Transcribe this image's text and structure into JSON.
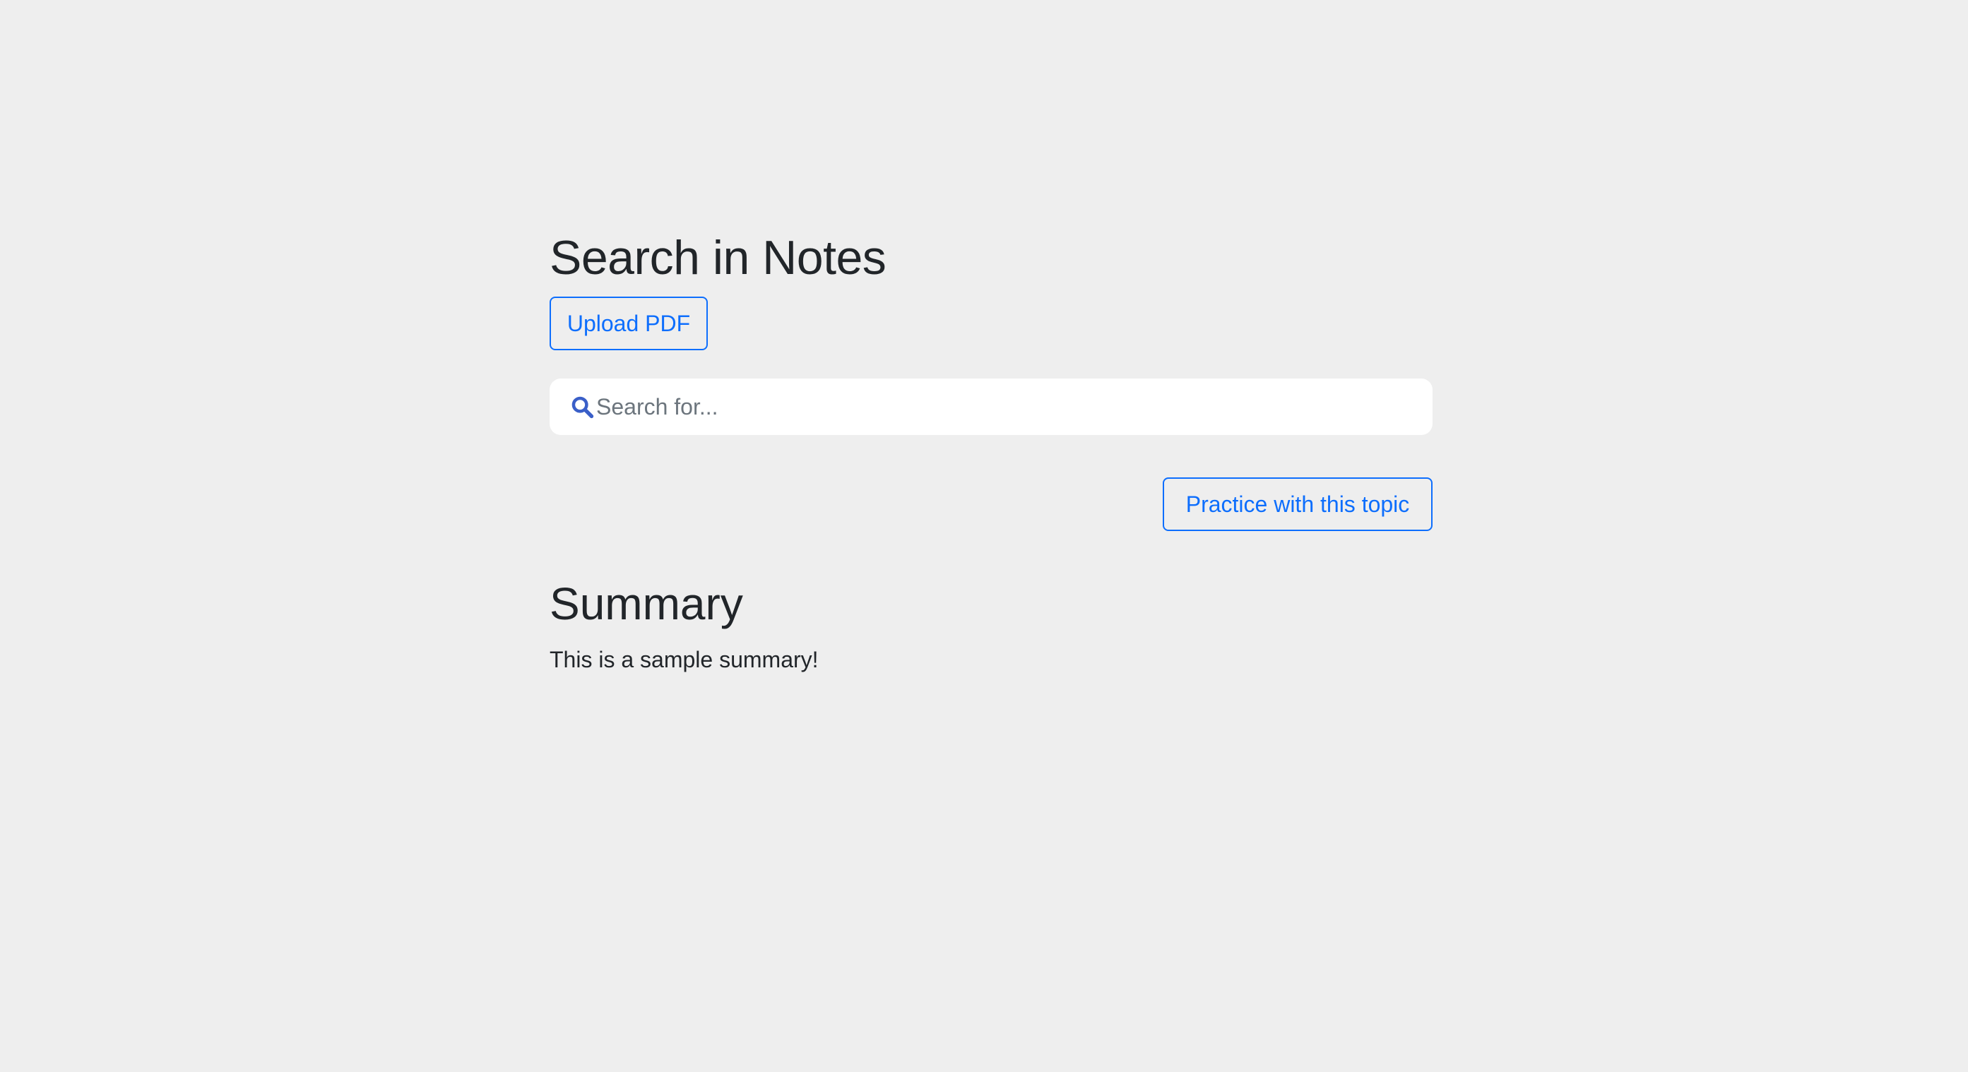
{
  "header": {
    "title": "Search in Notes",
    "upload_label": "Upload PDF"
  },
  "search": {
    "icon": "search-icon",
    "placeholder": "Search for...",
    "value": ""
  },
  "actions": {
    "practice_label": "Practice with this topic"
  },
  "summary": {
    "title": "Summary",
    "text": "This is a sample summary!"
  },
  "colors": {
    "background": "#eeeeee",
    "accent": "#0d6efd",
    "search_icon": "#3a5fc8",
    "text": "#212529",
    "placeholder": "#6c757d"
  }
}
